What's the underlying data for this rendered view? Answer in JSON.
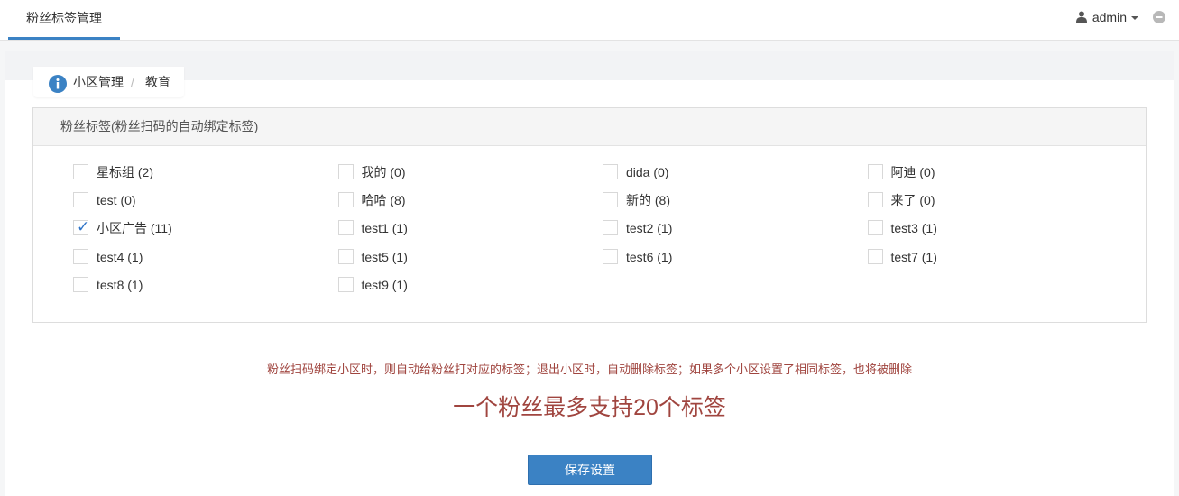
{
  "topbar": {
    "tab_label": "粉丝标签管理",
    "user_name": "admin",
    "user_icon": "user-icon",
    "message_icon": "message-icon"
  },
  "breadcrumb": {
    "items": [
      "小区管理",
      "教育"
    ],
    "separator": "/",
    "icon": "info-icon"
  },
  "panel": {
    "title": "粉丝标签(粉丝扫码的自动绑定标签)",
    "tags": [
      {
        "label": "星标组 (2)",
        "checked": false
      },
      {
        "label": "我的 (0)",
        "checked": false
      },
      {
        "label": "dida (0)",
        "checked": false
      },
      {
        "label": "阿迪 (0)",
        "checked": false
      },
      {
        "label": "test (0)",
        "checked": false
      },
      {
        "label": "哈哈 (8)",
        "checked": false
      },
      {
        "label": "新的 (8)",
        "checked": false
      },
      {
        "label": "来了 (0)",
        "checked": false
      },
      {
        "label": "小区广告 (11)",
        "checked": true
      },
      {
        "label": "test1 (1)",
        "checked": false
      },
      {
        "label": "test2 (1)",
        "checked": false
      },
      {
        "label": "test3 (1)",
        "checked": false
      },
      {
        "label": "test4 (1)",
        "checked": false
      },
      {
        "label": "test5 (1)",
        "checked": false
      },
      {
        "label": "test6 (1)",
        "checked": false
      },
      {
        "label": "test7 (1)",
        "checked": false
      },
      {
        "label": "test8 (1)",
        "checked": false
      },
      {
        "label": "test9 (1)",
        "checked": false
      }
    ]
  },
  "notice": "粉丝扫码绑定小区时，则自动给粉丝打对应的标签；退出小区时，自动删除标签；如果多个小区设置了相同标签，也将被删除",
  "big_tip": "一个粉丝最多支持20个标签",
  "save_button": "保存设置",
  "colors": {
    "accent": "#3b82c4",
    "warning_text": "#a0453f"
  }
}
